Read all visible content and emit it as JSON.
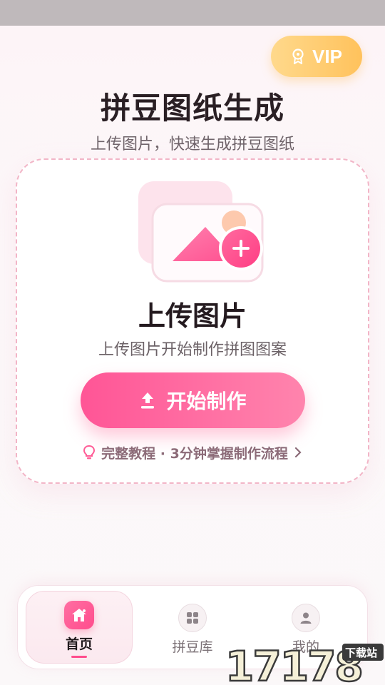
{
  "header": {
    "vip_label": "VIP",
    "title": "拼豆图纸生成",
    "subtitle": "上传图片，快速生成拼豆图纸"
  },
  "upload_card": {
    "title": "上传图片",
    "subtitle": "上传图片开始制作拼图图案",
    "start_button": "开始制作",
    "tutorial_link": "完整教程 · 3分钟掌握制作流程"
  },
  "bottom_nav": {
    "items": [
      {
        "label": "首页",
        "icon": "home-icon",
        "active": true
      },
      {
        "label": "拼豆库",
        "icon": "grid-icon",
        "active": false
      },
      {
        "label": "我的",
        "icon": "user-icon",
        "active": false
      }
    ]
  },
  "watermark": {
    "text": "17178",
    "badge": "下载站"
  },
  "colors": {
    "accent": "#ff5596",
    "vip_gold": "#ffc25c",
    "card_border": "#f2b5c7",
    "text_primary": "#2a1f24"
  }
}
